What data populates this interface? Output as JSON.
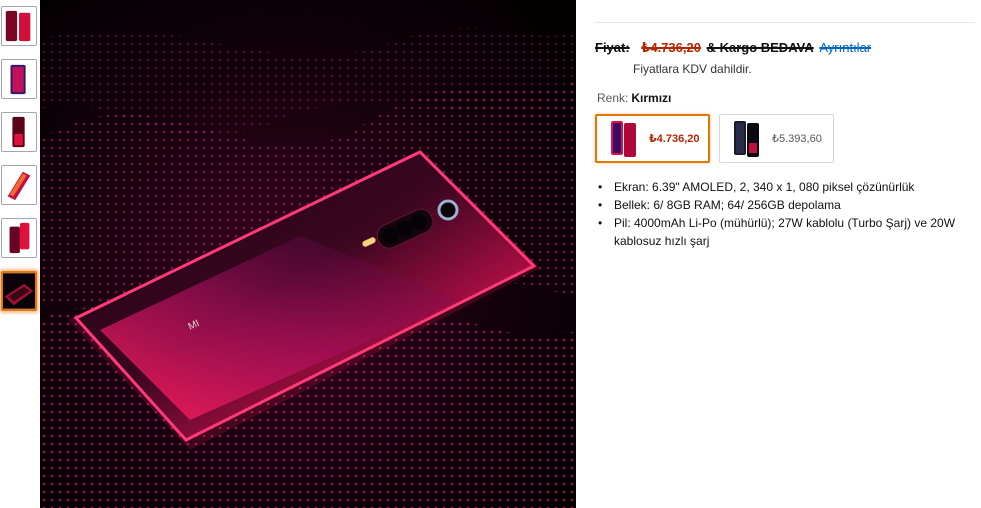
{
  "thumbnails": [
    {
      "alt": "thumb-1"
    },
    {
      "alt": "thumb-2"
    },
    {
      "alt": "thumb-3"
    },
    {
      "alt": "thumb-4"
    },
    {
      "alt": "thumb-5"
    },
    {
      "alt": "thumb-6",
      "selected": true
    }
  ],
  "product_image": {
    "brand_mark": "MI"
  },
  "price": {
    "label": "Fiyat:",
    "value": "₺4.736,20",
    "shipping": "& Kargo BEDAVA",
    "details_link": "Ayrıntılar",
    "vat_note": "Fiyatlara KDV dahildir."
  },
  "color": {
    "label": "Renk:",
    "value": "Kırmızı",
    "options": [
      {
        "price": "₺4.736,20",
        "selected": true
      },
      {
        "price": "₺5.393,60",
        "selected": false
      }
    ]
  },
  "features": [
    "Ekran: 6.39\" AMOLED, 2, 340 x 1, 080 piksel çözünürlük",
    "Bellek: 6/ 8GB RAM; 64/ 256GB depolama",
    "Pil: 4000mAh Li-Po (mühürlü); 27W kablolu (Turbo Şarj) ve 20W kablosuz hızlı şarj"
  ],
  "colors": {
    "accent_orange": "#e77600",
    "price_red": "#b12704",
    "link_blue": "#0066c0",
    "phone_red": "#e0103f"
  }
}
